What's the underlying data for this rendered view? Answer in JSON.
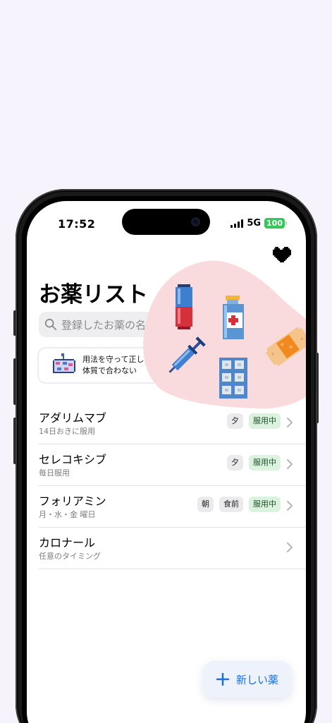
{
  "status": {
    "time": "17:52",
    "network": "5G",
    "battery": "100"
  },
  "page": {
    "title": "お薬リスト"
  },
  "search": {
    "placeholder": "登録したお薬の名"
  },
  "notice": {
    "line1": "用法を守って正し",
    "line2": "体質で合わない"
  },
  "medications": [
    {
      "name": "アダリムマブ",
      "schedule": "14日おきに服用",
      "tags": [
        "夕"
      ],
      "status": "服用中"
    },
    {
      "name": "セレコキシブ",
      "schedule": "毎日服用",
      "tags": [
        "夕"
      ],
      "status": "服用中"
    },
    {
      "name": "フォリアミン",
      "schedule": "月・水・金 曜日",
      "tags": [
        "朝",
        "食前"
      ],
      "status": "服用中"
    },
    {
      "name": "カロナール",
      "schedule": "任意のタイミング",
      "tags": [],
      "status": ""
    }
  ],
  "fab": {
    "label": "新しい薬"
  },
  "colors": {
    "accent": "#1d6fe0",
    "active_tag": "#daf2de",
    "blob": "#fadbdd",
    "battery": "#34c759"
  },
  "icons": [
    "heart-icon",
    "search-icon",
    "pill-sheet-icon",
    "capsule-icon",
    "medicine-bottle-icon",
    "syringe-icon",
    "blister-pack-icon",
    "bandage-icon",
    "chevron-right-icon",
    "plus-icon"
  ]
}
